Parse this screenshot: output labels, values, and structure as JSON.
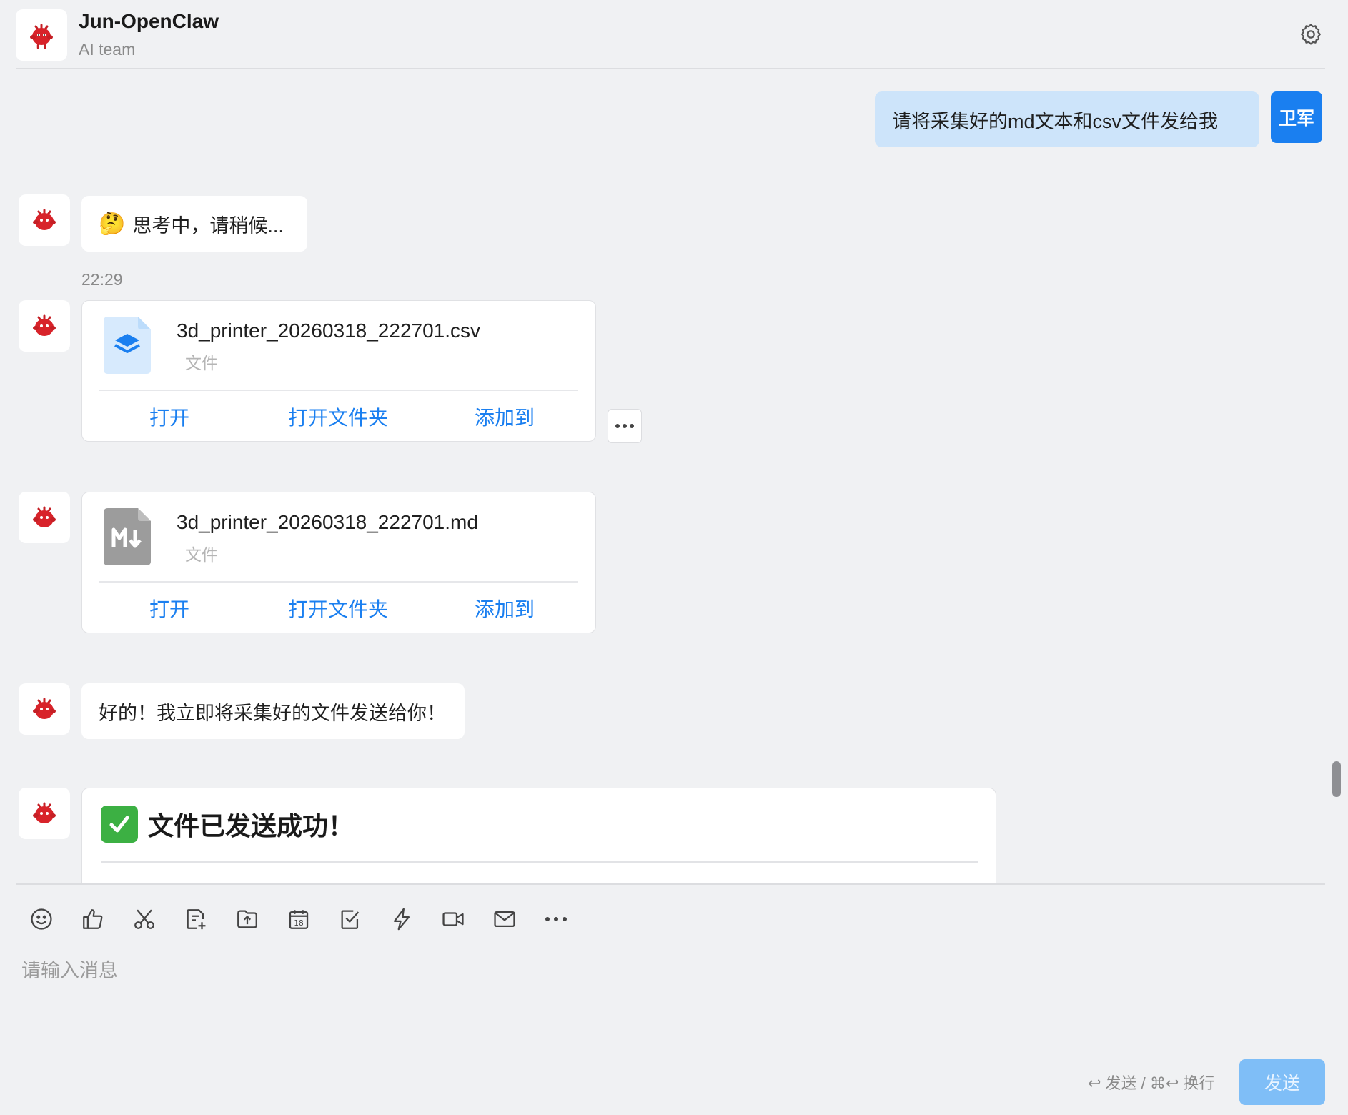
{
  "header": {
    "title": "Jun-OpenClaw",
    "subtitle": "AI team",
    "settings_icon": "gear-icon"
  },
  "bot": {
    "avatar_icon": "red-bird-icon",
    "avatar_color": "#d8232a"
  },
  "user": {
    "avatar_label": "卫军",
    "avatar_color": "#1a7ff0"
  },
  "messages": {
    "user_request": "请将采集好的md文本和csv文件发给我",
    "thinking_emoji": "🤔",
    "thinking": "思考中，请稍候...",
    "timestamp": "22:29",
    "reply": "好的！我立即将采集好的文件发送给你！",
    "success_emoji": "✅",
    "success_title": "文件已发送成功！"
  },
  "files": [
    {
      "name": "3d_printer_20260318_222701.csv",
      "type": "文件",
      "icon": "layers-file-icon",
      "actions": {
        "open": "打开",
        "open_folder": "打开文件夹",
        "add_to": "添加到"
      }
    },
    {
      "name": "3d_printer_20260318_222701.md",
      "type": "文件",
      "icon": "markdown-file-icon",
      "actions": {
        "open": "打开",
        "open_folder": "打开文件夹",
        "add_to": "添加到"
      }
    }
  ],
  "more_icon": "ellipsis-icon",
  "toolbar": {
    "icons": [
      "emoji-icon",
      "thumbs-up-icon",
      "scissors-icon",
      "new-doc-icon",
      "upload-folder-icon",
      "calendar-icon",
      "checkbox-icon",
      "lightning-icon",
      "video-icon",
      "mail-icon",
      "more-icon"
    ],
    "calendar_day": "18"
  },
  "composer": {
    "placeholder": "请输入消息",
    "hint": "↩ 发送 / ⌘↩ 换行",
    "send_label": "发送"
  },
  "colors": {
    "accent": "#1a7ff0",
    "user_bubble": "#cde4fa",
    "send_disabled": "#7fbef7",
    "success_green": "#3cb043"
  }
}
